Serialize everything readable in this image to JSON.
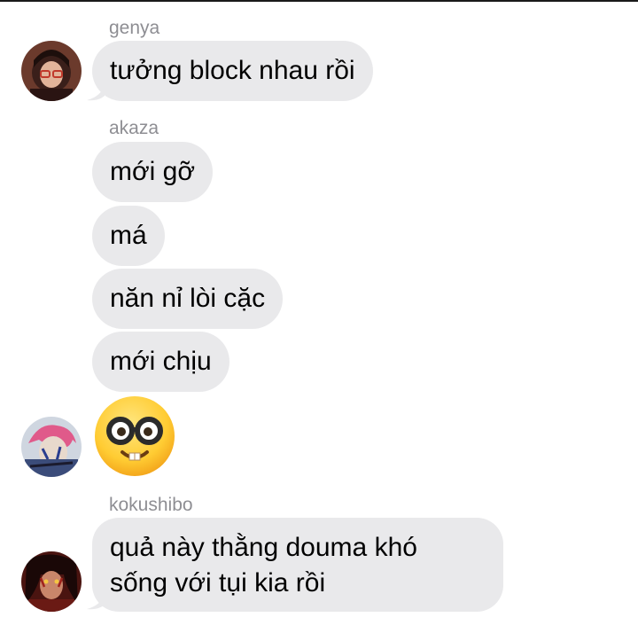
{
  "messages": [
    {
      "sender": "genya",
      "texts": [
        "tưởng block nhau rồi"
      ]
    },
    {
      "sender": "akaza",
      "texts": [
        "mới gỡ",
        "má",
        "năn nỉ lòi cặc",
        "mới chịu"
      ],
      "emoji": "nerd-face"
    },
    {
      "sender": "kokushibo",
      "texts": [
        "quả này thằng douma khó",
        "sống với tụi kia rồi"
      ]
    }
  ],
  "colors": {
    "bubble": "#e9e9eb",
    "sender_name": "#8e8e93",
    "text": "#000000"
  },
  "icons": {
    "avatar_genya": "avatar-genya",
    "avatar_akaza": "avatar-akaza",
    "avatar_kokushibo": "avatar-kokushibo"
  }
}
